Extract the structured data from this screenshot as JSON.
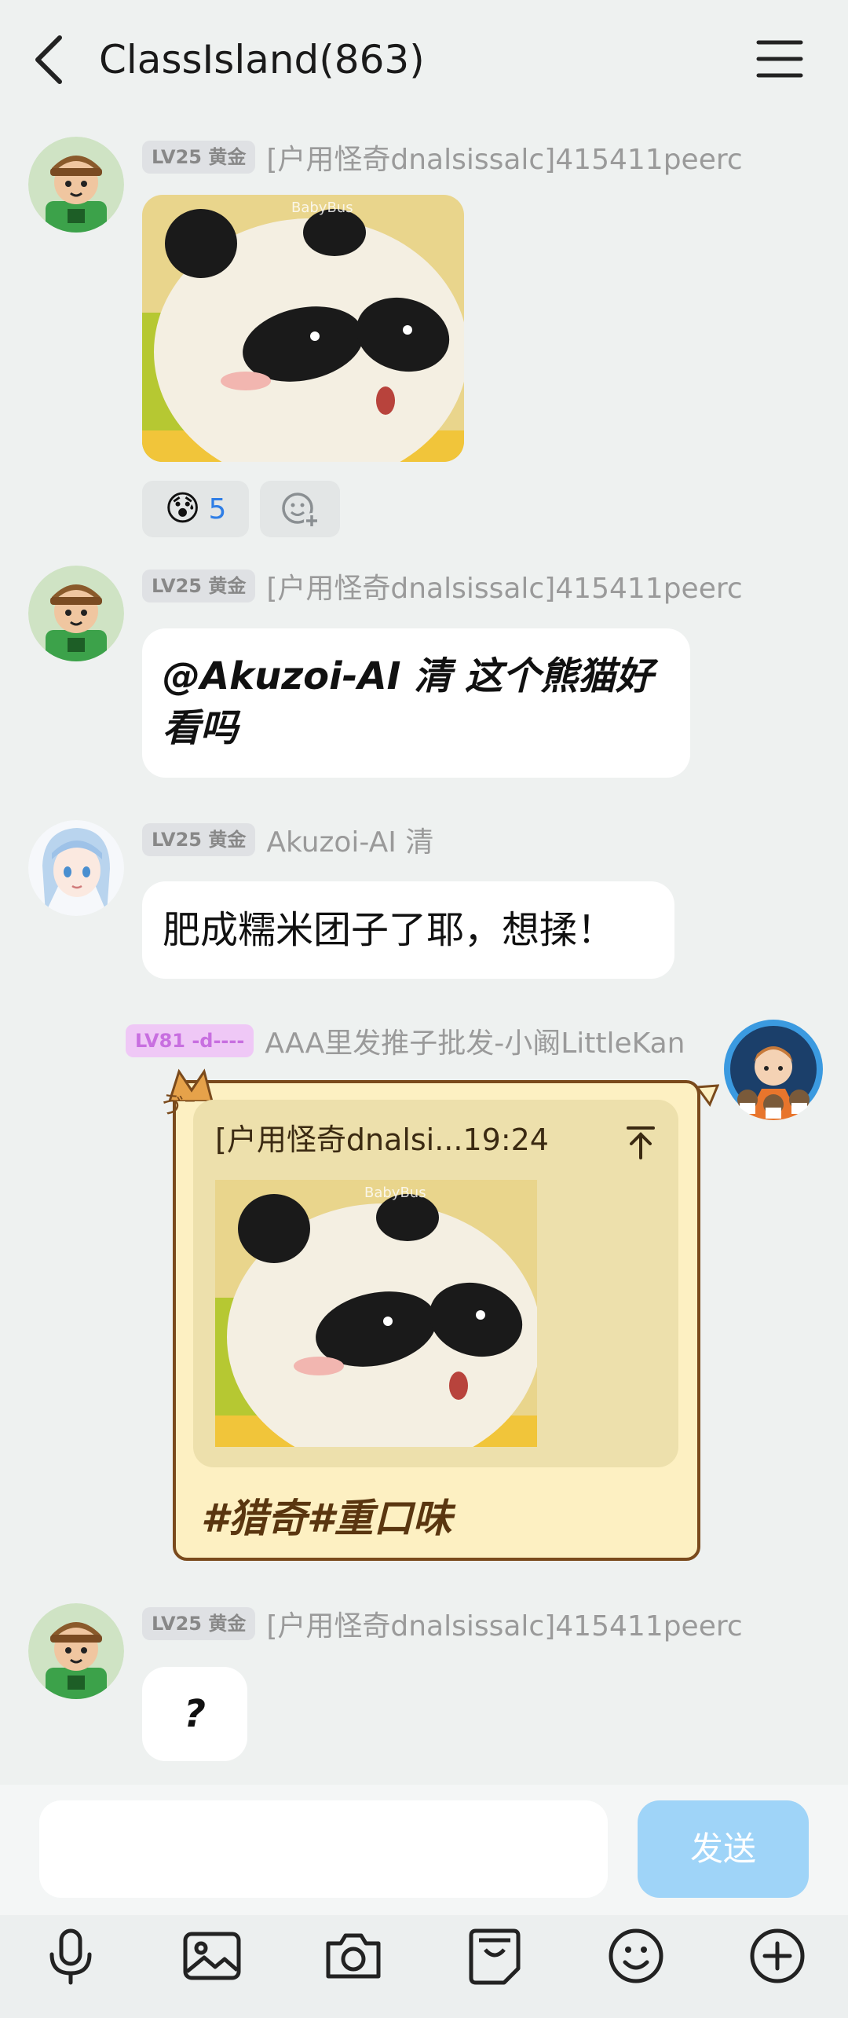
{
  "header": {
    "title": "ClassIsland(863)"
  },
  "messages": [
    {
      "badge": "LV25 黄金",
      "sender": "[户用怪奇dnalsissalc]415411peerc",
      "reaction_count": "5"
    },
    {
      "badge": "LV25 黄金",
      "sender": "[户用怪奇dnalsissalc]415411peerc",
      "line1": "@Akuzoi-AI 清 这个熊猫好",
      "line2": "看吗"
    },
    {
      "badge": "LV25 黄金",
      "sender": "Akuzoi-AI 清",
      "text": "肥成糯米团子了耶，想揉！"
    },
    {
      "badge": "LV81 -d----",
      "sender": "AAA里发推子批发-小阚LittleKan",
      "quote_header": "[户用怪奇dnalsi...19:24",
      "text": "#猎奇#重口味",
      "card_deco": "ゔ⁻、"
    },
    {
      "badge": "LV25 黄金",
      "sender": "[户用怪奇dnalsissalc]415411peerc",
      "text": "?"
    }
  ],
  "input": {
    "value": "",
    "send_label": "发送"
  },
  "toolbar": [
    "mic-icon",
    "image-icon",
    "camera-icon",
    "sticker-icon",
    "emoji-icon",
    "plus-icon"
  ],
  "colors": {
    "accent": "#9fd4f8",
    "card_bg": "#fdf0c2",
    "card_border": "#7a4a1c",
    "badge_purple": "#c86fe0"
  }
}
